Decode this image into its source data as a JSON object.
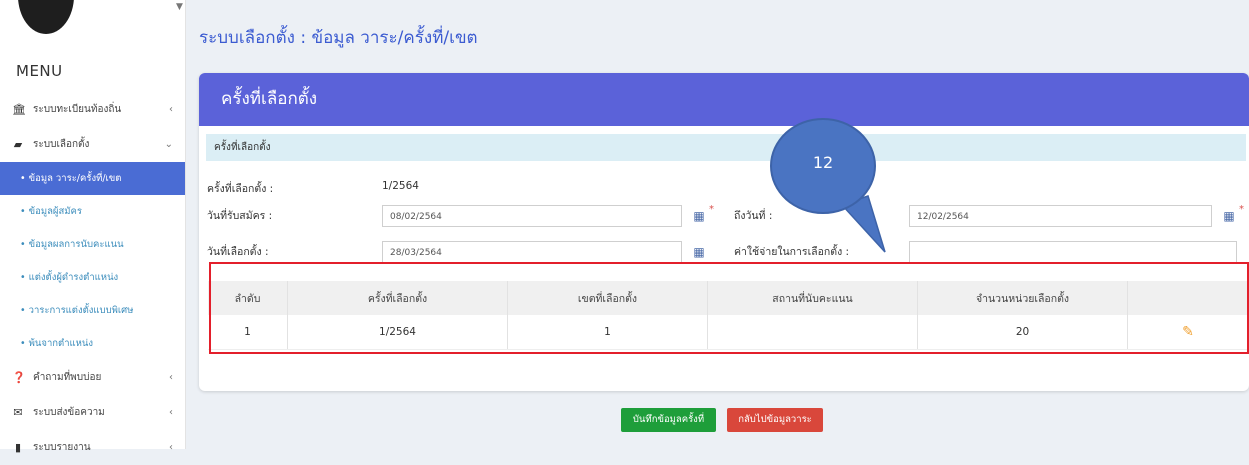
{
  "sidebar": {
    "menu_title": "MENU",
    "items": [
      {
        "label": "ระบบทะเบียนท้องถิ่น",
        "icon": "bank-icon",
        "icon_glyph": "🏛",
        "chevron": "‹"
      },
      {
        "label": "ระบบเลือกตั้ง",
        "icon": "briefcase-icon",
        "icon_glyph": "▰",
        "chevron": "⌄"
      }
    ],
    "subitems": [
      {
        "label": "• ข้อมูล วาระ/ครั้งที่/เขต",
        "active": true
      },
      {
        "label": "• ข้อมูลผู้สมัคร"
      },
      {
        "label": "• ข้อมูลผลการนับคะแนน"
      },
      {
        "label": "• แต่งตั้งผู้ดำรงตำแหน่ง"
      },
      {
        "label": "• วาระการแต่งตั้งแบบพิเศษ"
      },
      {
        "label": "• พ้นจากตำแหน่ง"
      }
    ],
    "bottom_items": [
      {
        "label": "คำถามที่พบบ่อย",
        "icon": "question-icon",
        "icon_glyph": "❓",
        "chevron": "‹"
      },
      {
        "label": "ระบบส่งข้อความ",
        "icon": "envelope-icon",
        "icon_glyph": "✉",
        "chevron": "‹"
      },
      {
        "label": "ระบบรายงาน",
        "icon": "file-icon",
        "icon_glyph": "▮",
        "chevron": "‹"
      }
    ]
  },
  "page": {
    "title": "ระบบเลือกตั้ง : ข้อมูล วาระ/ครั้งที่/เขต"
  },
  "card": {
    "header": "ครั้งที่เลือกตั้ง",
    "section": "ครั้งที่เลือกตั้ง",
    "fields": {
      "round_label": "ครั้งที่เลือกตั้ง :",
      "round_value": "1/2564",
      "apply_date_label": "วันที่รับสมัคร :",
      "apply_date_value": "08/02/2564",
      "to_date_label": "ถึงวันที่ :",
      "to_date_value": "12/02/2564",
      "election_date_label": "วันที่เลือกตั้ง :",
      "election_date_value": "28/03/2564",
      "expense_label": "ค่าใช้จ่ายในการเลือกตั้ง :",
      "expense_value": ""
    },
    "table": {
      "headers": [
        "ลำดับ",
        "ครั้งที่เลือกตั้ง",
        "เขตที่เลือกตั้ง",
        "สถานที่นับคะแนน",
        "จำนวนหน่วยเลือกตั้ง",
        ""
      ],
      "rows": [
        [
          "1",
          "1/2564",
          "1",
          "",
          "20"
        ]
      ]
    }
  },
  "annotation": {
    "number": "12",
    "color": "#4a74c2",
    "outline_color": "#e31f2b"
  },
  "buttons": {
    "save": "บันทึกข้อมูลครั้งที่",
    "back": "กลับไปข้อมูลวาระ"
  },
  "colors": {
    "accent": "#5b62d9",
    "active_nav": "#4a6cd4",
    "save": "#1e9e3a",
    "back": "#d9473b"
  }
}
